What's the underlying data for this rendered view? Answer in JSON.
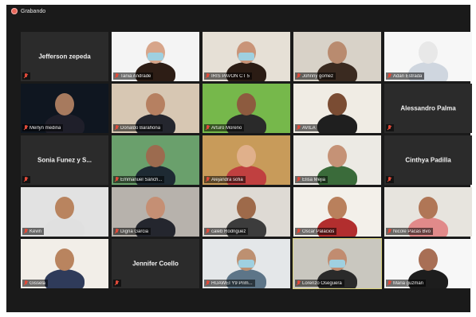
{
  "recording": {
    "label": "Grabando",
    "color": "#e8665a"
  },
  "participants": [
    {
      "name": "Jefferson zepeda",
      "video": false,
      "muted": true
    },
    {
      "name": "Tania Andrade",
      "video": true,
      "muted": true
    },
    {
      "name": "IRIS PAVON CT 5",
      "video": true,
      "muted": true
    },
    {
      "name": "Johnny gomez",
      "video": true,
      "muted": true
    },
    {
      "name": "Adan Estrada",
      "video": true,
      "muted": true
    },
    {
      "name": "Merlyn medina",
      "video": true,
      "muted": true
    },
    {
      "name": "Donaldo Barahona",
      "video": true,
      "muted": true
    },
    {
      "name": "Arturo Moreno",
      "video": true,
      "muted": true
    },
    {
      "name": "AVILA",
      "video": true,
      "muted": true
    },
    {
      "name": "Alessandro Palma",
      "video": false,
      "muted": true
    },
    {
      "name": "Sonia Funez y S...",
      "video": false,
      "muted": true
    },
    {
      "name": "Emmanuel Sánch...",
      "video": true,
      "muted": true
    },
    {
      "name": "Alejandra sofia",
      "video": true,
      "muted": true
    },
    {
      "name": "Elisa Mejia",
      "video": true,
      "muted": true
    },
    {
      "name": "Cinthya Padilla",
      "video": false,
      "muted": true
    },
    {
      "name": "Kevin",
      "video": true,
      "muted": true
    },
    {
      "name": "Digna Garcia",
      "video": true,
      "muted": true
    },
    {
      "name": "caleb Rodriguez",
      "video": true,
      "muted": true
    },
    {
      "name": "Oscar Palacios",
      "video": true,
      "muted": true
    },
    {
      "name": "Nicole Pacas Bvo",
      "video": true,
      "muted": true
    },
    {
      "name": "Gissela",
      "video": true,
      "muted": true
    },
    {
      "name": "Jennifer Coello",
      "video": false,
      "muted": true
    },
    {
      "name": "HUAWEI Y9 Prim...",
      "video": true,
      "muted": true
    },
    {
      "name": "Lorenzo Oseguera",
      "video": true,
      "muted": true,
      "active": true
    },
    {
      "name": "Maria guzman",
      "video": true,
      "muted": true
    }
  ]
}
